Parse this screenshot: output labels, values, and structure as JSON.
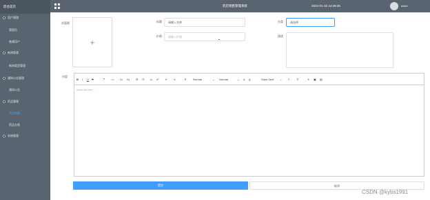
{
  "sidebar": {
    "logo": "后台首页",
    "items": [
      {
        "label": "用户管理"
      },
      {
        "label": "管理员"
      },
      {
        "label": "普通用户"
      },
      {
        "label": "新闻管理"
      },
      {
        "label": "新闻类型管理"
      },
      {
        "label": "通知公告管理"
      },
      {
        "label": "通知公告"
      },
      {
        "label": "药品管理"
      },
      {
        "label": "药品列表"
      },
      {
        "label": "药品分类"
      },
      {
        "label": "系统管理"
      }
    ]
  },
  "header": {
    "title": "药店销售管理系统",
    "datetime": "2024-01-16 14:29:45",
    "user": "admin"
  },
  "form": {
    "cover_label": "封面图",
    "name_label": "标题",
    "name_value": "请输入名称",
    "category_label": "分类",
    "category_value": "请选择",
    "price_label": "价格",
    "price_placeholder": "请输入价格",
    "remark_label": "描述",
    "content_label": "内容",
    "editor_placeholder": "Insert text here ...",
    "submit_label": "提交",
    "cancel_label": "取消"
  },
  "toolbar": {
    "heading_1": "Normal",
    "heading_2": "Normal",
    "font": "Sans Serif"
  },
  "watermark": "CSDN @kybs1991"
}
